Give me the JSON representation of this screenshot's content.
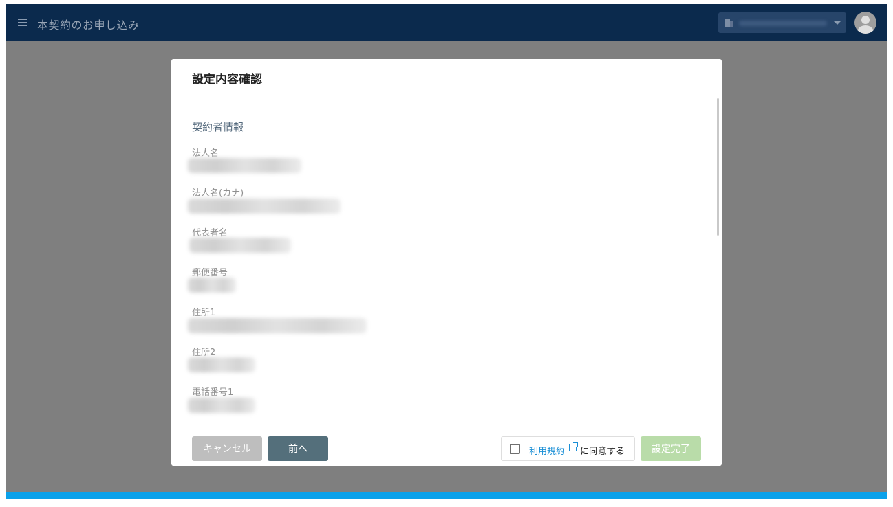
{
  "appbar": {
    "menu_icon": "hamburger-menu-icon",
    "title": "本契約のお申し込み",
    "org_icon": "building-icon",
    "avatar_icon": "user-avatar-icon"
  },
  "dialog": {
    "title": "設定内容確認",
    "section_title": "契約者情報",
    "fields": [
      {
        "label": "法人名"
      },
      {
        "label": "法人名(カナ)"
      },
      {
        "label": "代表者名"
      },
      {
        "label": "郵便番号"
      },
      {
        "label": "住所1"
      },
      {
        "label": "住所2"
      },
      {
        "label": "電話番号1"
      }
    ],
    "footer": {
      "cancel_label": "キャンセル",
      "prev_label": "前へ",
      "terms_link": "利用規約",
      "agree_text": "に同意する",
      "complete_label": "設定完了"
    }
  },
  "colors": {
    "appbar_bg": "#0b2a4d",
    "overlay": "#7f7f7f",
    "accent_bar": "#0aa1ea",
    "prev_button": "#546f7b",
    "complete_button_disabled": "#b9dca9",
    "link": "#1a8fd6"
  }
}
